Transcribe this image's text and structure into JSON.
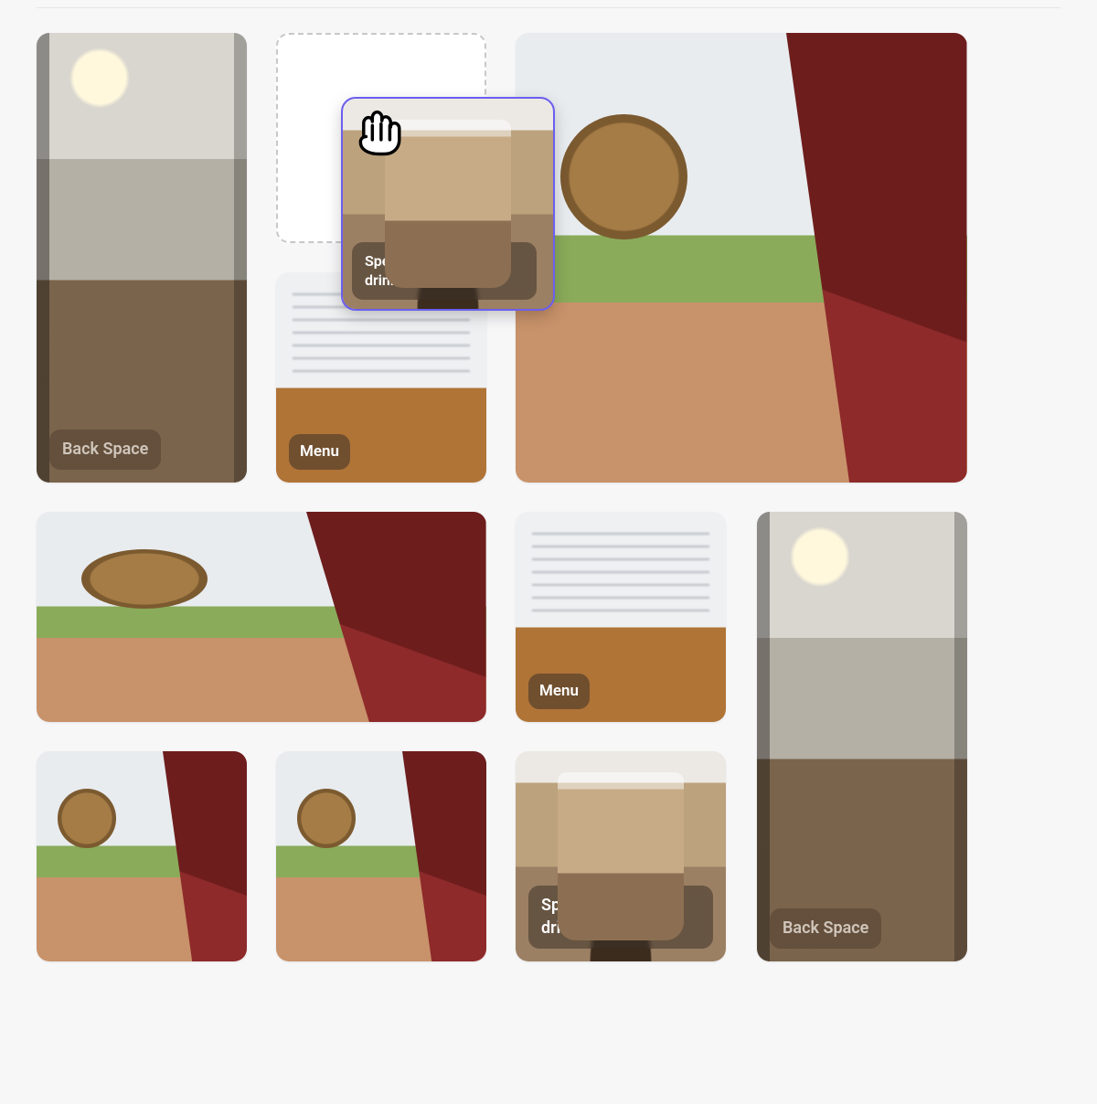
{
  "cards": {
    "back_space": {
      "label": "Back Space"
    },
    "menu": {
      "label": "Menu"
    },
    "speciality": {
      "label": "Speciality seasonal drink…"
    }
  },
  "drag": {
    "label": "Speciality seasonal drink…"
  }
}
